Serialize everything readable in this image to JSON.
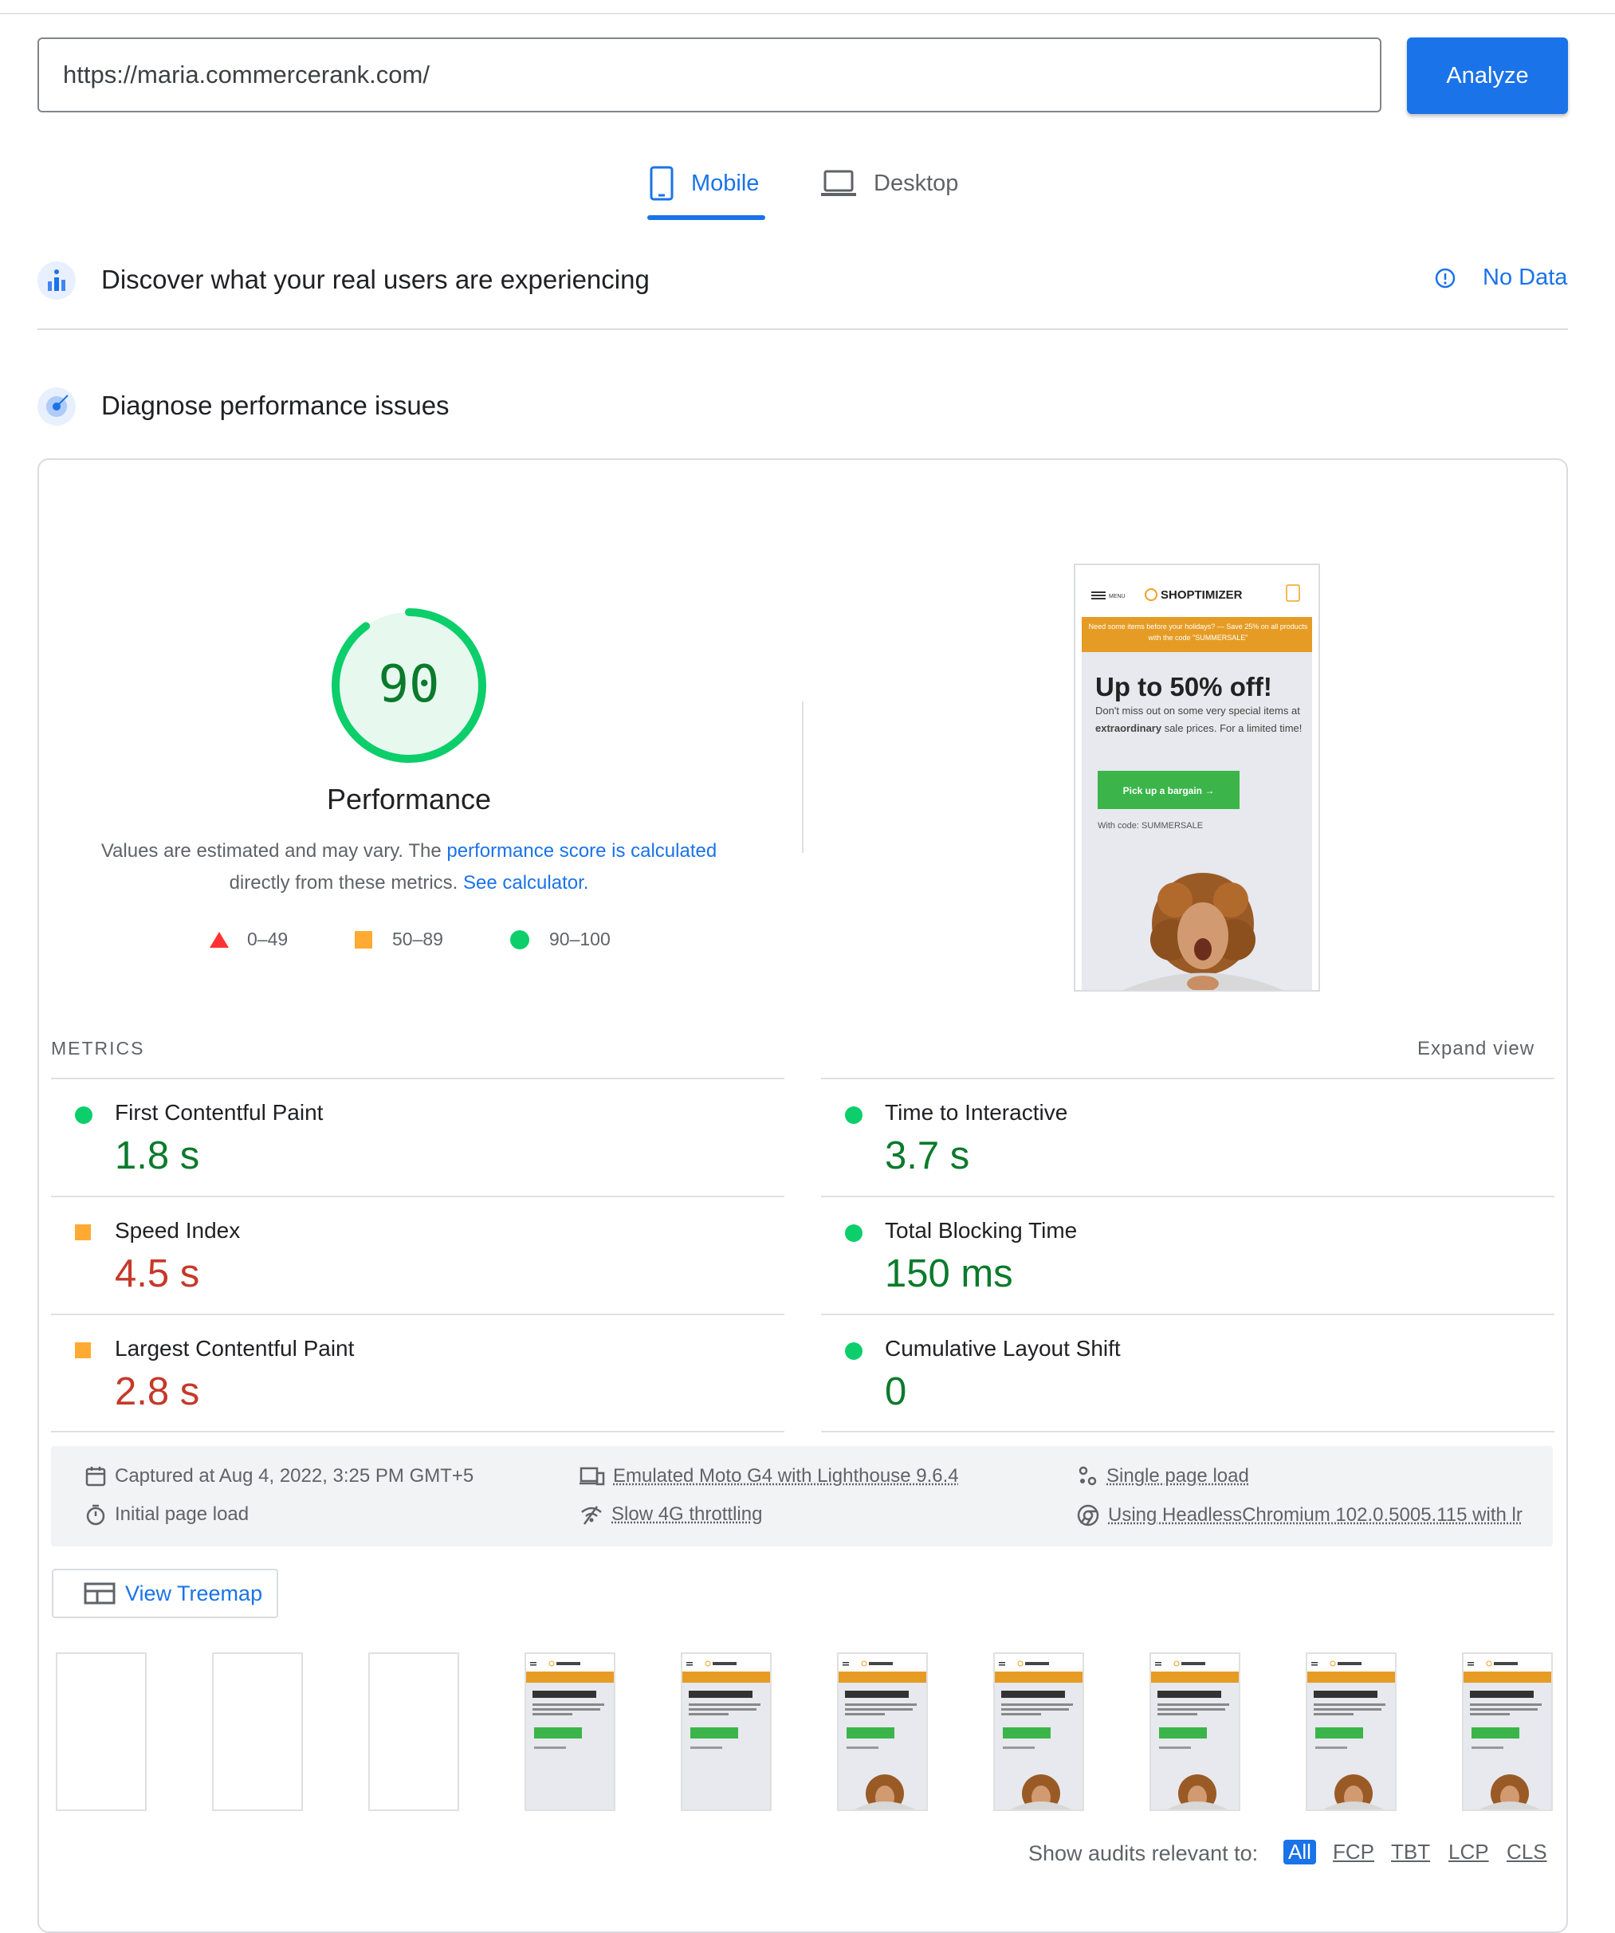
{
  "search": {
    "url": "https://maria.commercerank.com/",
    "analyze_label": "Analyze"
  },
  "tabs": [
    {
      "label": "Mobile",
      "active": true,
      "icon": "phone-icon"
    },
    {
      "label": "Desktop",
      "active": false,
      "icon": "laptop-icon"
    }
  ],
  "field_data": {
    "title": "Discover what your real users are experiencing",
    "status": "No Data"
  },
  "lab_data": {
    "title": "Diagnose performance issues"
  },
  "performance": {
    "score": "90",
    "score_fraction": 0.9,
    "title": "Performance",
    "desc_prefix": "Values are estimated and may vary. The ",
    "desc_link1": "performance score is calculated",
    "desc_middle": " directly from these metrics. ",
    "desc_link2": "See calculator.",
    "legend": [
      {
        "range": "0–49",
        "shape": "triangle",
        "color": "#ff3333"
      },
      {
        "range": "50–89",
        "shape": "square",
        "color": "#ffaa33"
      },
      {
        "range": "90–100",
        "shape": "circle",
        "color": "#0cce6b"
      }
    ]
  },
  "screenshot": {
    "menu": "MENU",
    "brand": "SHOPTIMIZER",
    "banner": "Need some items before your holidays? — Save 25% on all products with the code \"SUMMERSALE\"",
    "headline": "Up to 50% off!",
    "body_pre": "Don't miss out on some very special items at ",
    "body_bold": "extraordinary",
    "body_post": " sale prices. For a limited time!",
    "cta": "Pick up a bargain →",
    "code": "With code: SUMMERSALE"
  },
  "metrics": {
    "label": "METRICS",
    "expand": "Expand view",
    "items": [
      {
        "name": "First Contentful Paint",
        "value": "1.8 s",
        "status": "good"
      },
      {
        "name": "Time to Interactive",
        "value": "3.7 s",
        "status": "good"
      },
      {
        "name": "Speed Index",
        "value": "4.5 s",
        "status": "average"
      },
      {
        "name": "Total Blocking Time",
        "value": "150 ms",
        "status": "good"
      },
      {
        "name": "Largest Contentful Paint",
        "value": "2.8 s",
        "status": "average"
      },
      {
        "name": "Cumulative Layout Shift",
        "value": "0",
        "status": "good"
      }
    ]
  },
  "env": {
    "captured": "Captured at Aug 4, 2022, 3:25 PM GMT+5",
    "initial": "Initial page load",
    "device": "Emulated Moto G4 with Lighthouse 9.6.4",
    "throttling": "Slow 4G throttling",
    "session": "Single page load",
    "browser": "Using HeadlessChromium 102.0.5005.115 with lr"
  },
  "treemap_label": "View Treemap",
  "filmstrip": {
    "blank_frames": 3,
    "loaded_frames": 7
  },
  "filters": {
    "label": "Show audits relevant to:",
    "items": [
      "All",
      "FCP",
      "TBT",
      "LCP",
      "CLS"
    ],
    "active": "All"
  },
  "colors": {
    "accent": "#1a73e8",
    "good": "#0cce6b",
    "average": "#ffaa33",
    "poor": "#ff3333",
    "good_text": "#0a7a2b",
    "average_text": "#c53929"
  }
}
